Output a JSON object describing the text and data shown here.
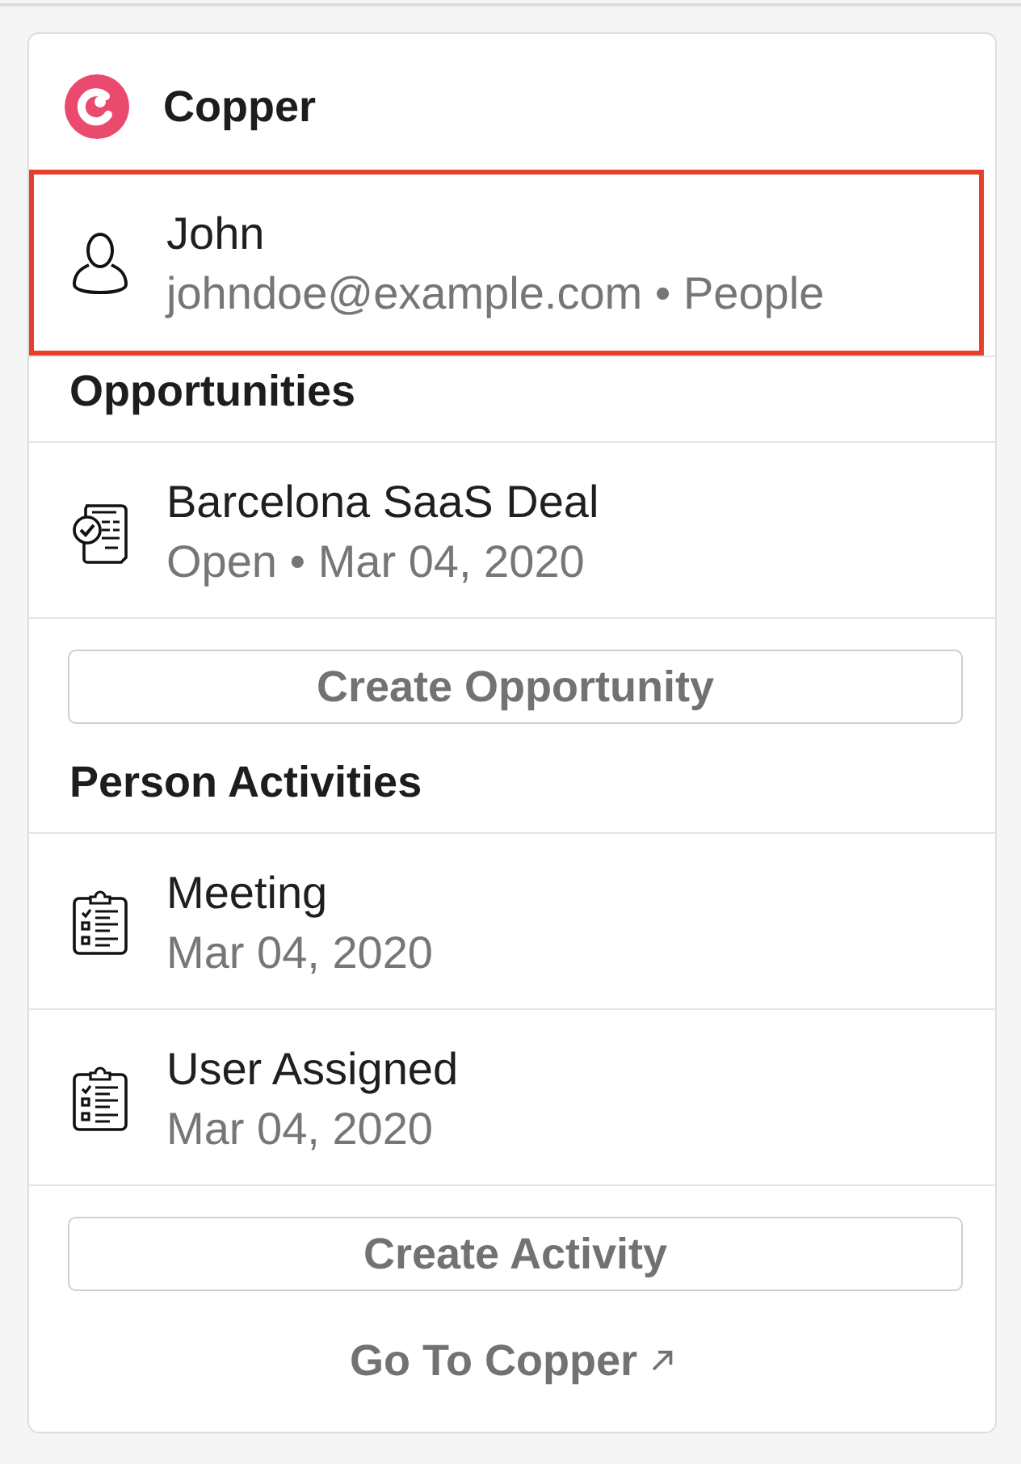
{
  "app": {
    "name": "Copper"
  },
  "contact": {
    "name": "John",
    "detail": "johndoe@example.com • People",
    "selected": true
  },
  "opportunities": {
    "heading": "Opportunities",
    "items": [
      {
        "title": "Barcelona SaaS Deal",
        "detail": "Open • Mar 04, 2020"
      }
    ],
    "button": "Create Opportunity"
  },
  "activities": {
    "heading": "Person Activities",
    "items": [
      {
        "title": "Meeting",
        "detail": "Mar 04, 2020"
      },
      {
        "title": "User Assigned",
        "detail": "Mar 04, 2020"
      }
    ],
    "button": "Create Activity"
  },
  "footer": {
    "link": "Go To Copper"
  }
}
